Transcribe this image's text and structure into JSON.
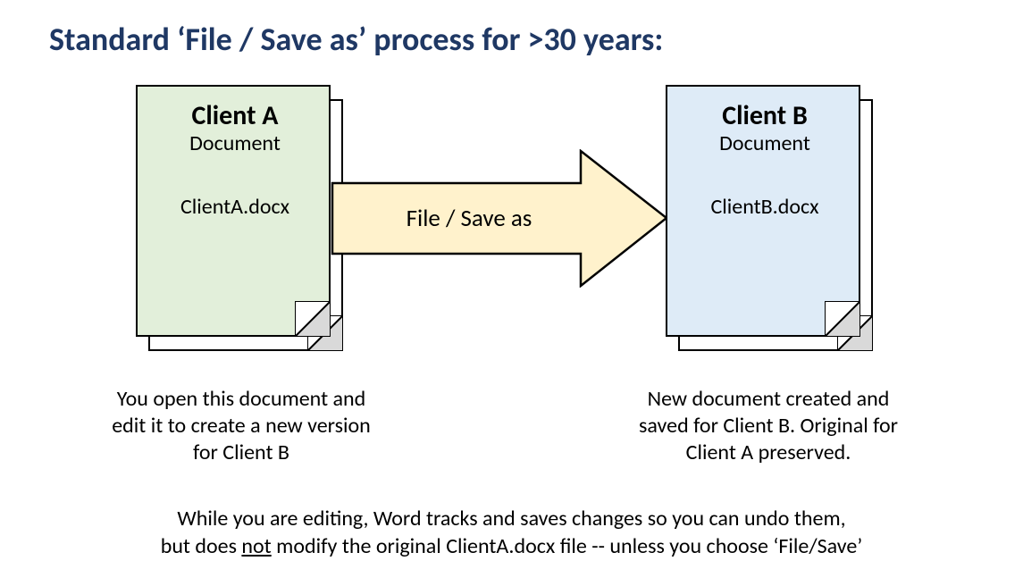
{
  "title": "Standard ‘File / Save as’ process for >30 years:",
  "docA": {
    "client": "Client A",
    "sub": "Document",
    "file": "ClientA.docx",
    "caption": "You open this document and edit it to create a new version for Client B"
  },
  "docB": {
    "client": "Client B",
    "sub": "Document",
    "file": "ClientB.docx",
    "caption": "New document created and saved for Client B.  Original for Client A preserved."
  },
  "arrow_label": "File / Save as",
  "footer_line1": "While you are editing, Word tracks and saves changes so you can undo them,",
  "footer_pre": "but does ",
  "footer_not": "not",
  "footer_post": " modify the original ClientA.docx file -- unless you choose ‘File/Save’",
  "colors": {
    "title": "#1f3864",
    "doc_green": "#e2efda",
    "doc_blue": "#deebf7",
    "arrow_fill": "#fff2cc",
    "outline": "#000000"
  }
}
